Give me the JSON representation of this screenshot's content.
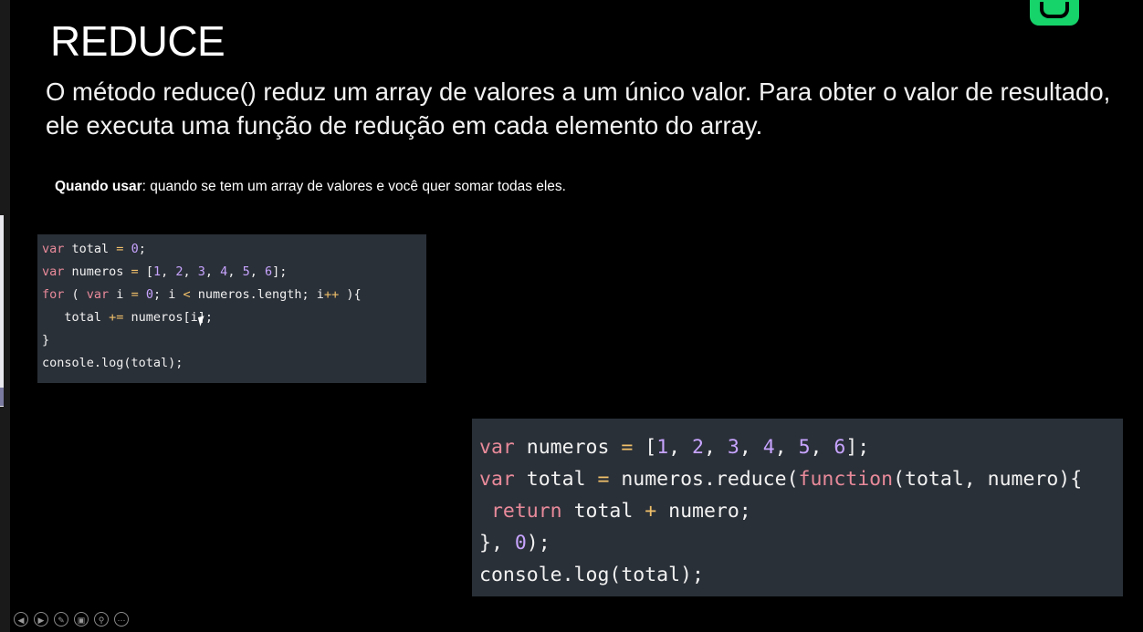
{
  "slide": {
    "title": "REDUCE",
    "description": "O método reduce() reduz um array de valores a um único valor. Para obter o valor de resultado, ele executa uma função de redução em cada elemento do array.",
    "when_label": "Quando usar",
    "when_text": ": quando se tem um array de valores e você quer somar todas eles."
  },
  "code_block_1": {
    "lines": [
      "var total = 0;",
      "var numeros = [1, 2, 3, 4, 5, 6];",
      "for ( var i = 0; i < numeros.length; i++ ){",
      "   total += numeros[i];",
      "}",
      "console.log(total);"
    ]
  },
  "code_block_2": {
    "lines": [
      "var numeros = [1, 2, 3, 4, 5, 6];",
      "var total = numeros.reduce(function(total, numero){",
      " return total + numero;",
      "}, 0);",
      "console.log(total);"
    ]
  },
  "controls": [
    "prev-icon",
    "next-icon",
    "pen-icon",
    "slides-icon",
    "zoom-icon",
    "more-icon"
  ],
  "colors": {
    "background": "#000000",
    "code_background": "#2a3038",
    "keyword": "#e88a9a",
    "number": "#c7a4ff",
    "operator": "#f0c06a",
    "logo": "#16d36a"
  }
}
